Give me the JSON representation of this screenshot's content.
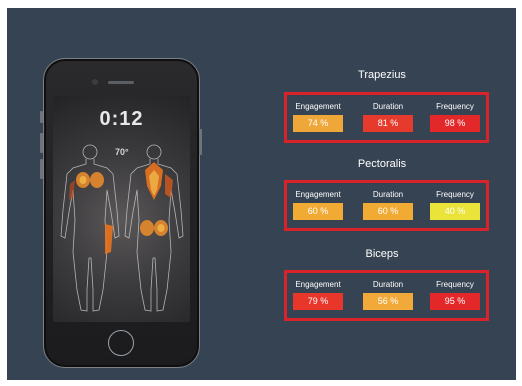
{
  "phone": {
    "timer": "0:12",
    "heart_rate": "70°"
  },
  "groups": [
    {
      "title": "Trapezius",
      "metrics": [
        {
          "label": "Engagement",
          "value": "74 %",
          "color": "#f0a73a"
        },
        {
          "label": "Duration",
          "value": "81 %",
          "color": "#e53a2c"
        },
        {
          "label": "Frequency",
          "value": "98 %",
          "color": "#e3282a"
        }
      ]
    },
    {
      "title": "Pectoralis",
      "metrics": [
        {
          "label": "Engagement",
          "value": "60 %",
          "color": "#f1ab35"
        },
        {
          "label": "Duration",
          "value": "60 %",
          "color": "#f1ab35"
        },
        {
          "label": "Frequency",
          "value": "40 %",
          "color": "#e9e33a"
        }
      ]
    },
    {
      "title": "Biceps",
      "metrics": [
        {
          "label": "Engagement",
          "value": "79 %",
          "color": "#e8362b"
        },
        {
          "label": "Duration",
          "value": "56 %",
          "color": "#f1aa3a"
        },
        {
          "label": "Frequency",
          "value": "95 %",
          "color": "#e3282a"
        }
      ]
    }
  ],
  "colors": {
    "background": "#364352",
    "highlight_border": "#d9232b"
  }
}
